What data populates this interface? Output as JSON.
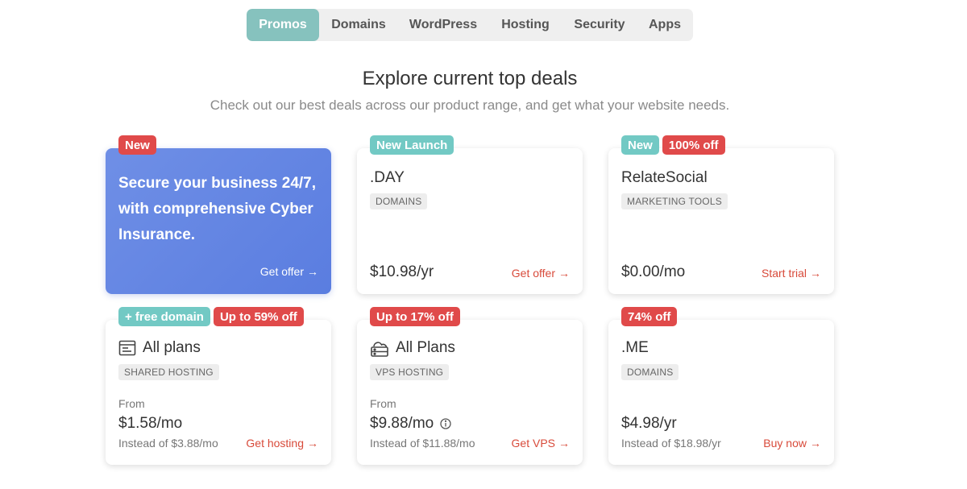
{
  "tabs": [
    {
      "label": "Promos",
      "active": true
    },
    {
      "label": "Domains",
      "active": false
    },
    {
      "label": "WordPress",
      "active": false
    },
    {
      "label": "Hosting",
      "active": false
    },
    {
      "label": "Security",
      "active": false
    },
    {
      "label": "Apps",
      "active": false
    }
  ],
  "hero": {
    "title": "Explore current top deals",
    "subtitle": "Check out our best deals across our product range, and get what your website needs."
  },
  "icons": {
    "arrow": "→",
    "shared_hosting": "browser-window-icon",
    "vps_hosting": "cloud-server-icon",
    "info": "info-icon"
  },
  "colors": {
    "accent_teal": "#86c2be",
    "badge_red": "#e04a4a",
    "badge_teal": "#72c9c4",
    "promo_blue": "#5f82e2",
    "cta_red": "#d84a3a"
  },
  "cards": {
    "insurance": {
      "badges": [
        "New"
      ],
      "text": "Secure your business 24/7, with comprehensive Cyber Insurance.",
      "cta": "Get offer"
    },
    "day": {
      "badges": [
        "New Launch"
      ],
      "title": ".DAY",
      "tag": "DOMAINS",
      "price": "$10.98/yr",
      "cta": "Get offer"
    },
    "relatesocial": {
      "badges": [
        "New",
        "100% off"
      ],
      "title": "RelateSocial",
      "tag": "MARKETING TOOLS",
      "price": "$0.00/mo",
      "cta": "Start trial"
    },
    "shared": {
      "badges": [
        "+ free domain",
        "Up to 59% off"
      ],
      "title": "All plans",
      "tag": "SHARED HOSTING",
      "from": "From",
      "price": "$1.58/mo",
      "instead": "Instead of $3.88/mo",
      "cta": "Get hosting"
    },
    "vps": {
      "badges": [
        "Up to 17% off"
      ],
      "title": "All Plans",
      "tag": "VPS HOSTING",
      "from": "From",
      "price": "$9.88/mo",
      "instead": "Instead of $11.88/mo",
      "cta": "Get VPS"
    },
    "me": {
      "badges": [
        "74% off"
      ],
      "title": ".ME",
      "tag": "DOMAINS",
      "price": "$4.98/yr",
      "instead": "Instead of $18.98/yr",
      "cta": "Buy now"
    }
  }
}
